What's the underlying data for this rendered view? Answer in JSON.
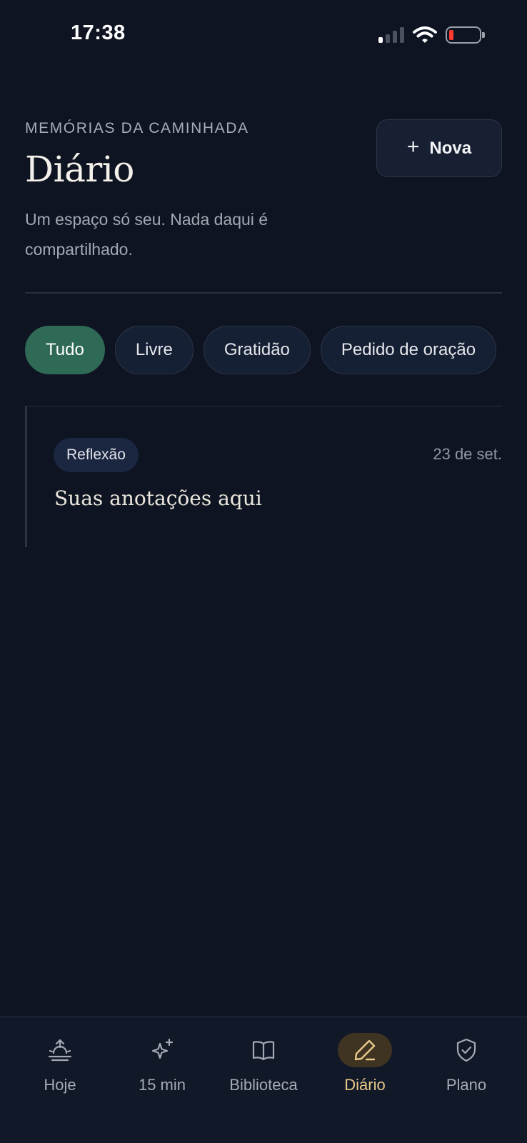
{
  "status_bar": {
    "time": "17:38"
  },
  "header": {
    "eyebrow": "MEMÓRIAS DA CAMINHADA",
    "title": "Diário",
    "subtitle": "Um espaço só seu. Nada daqui é compartilhado.",
    "new_button": {
      "icon": "plus-icon",
      "label": "Nova"
    }
  },
  "filters": [
    {
      "label": "Tudo",
      "active": true
    },
    {
      "label": "Livre",
      "active": false
    },
    {
      "label": "Gratidão",
      "active": false
    },
    {
      "label": "Pedido de oração",
      "active": false
    }
  ],
  "entries": [
    {
      "tag": "Reflexão",
      "date": "23 de set.",
      "text": "Suas anotações aqui"
    }
  ],
  "bottom_nav": [
    {
      "label": "Hoje",
      "icon": "sunrise-icon",
      "active": false
    },
    {
      "label": "15 min",
      "icon": "sparkles-icon",
      "active": false
    },
    {
      "label": "Biblioteca",
      "icon": "book-open-icon",
      "active": false
    },
    {
      "label": "Diário",
      "icon": "pencil-icon",
      "active": true
    },
    {
      "label": "Plano",
      "icon": "shield-check-icon",
      "active": false
    }
  ],
  "colors": {
    "background": "#0e1422",
    "accent_green": "#2f6a56",
    "accent_gold": "#e9c98a"
  }
}
